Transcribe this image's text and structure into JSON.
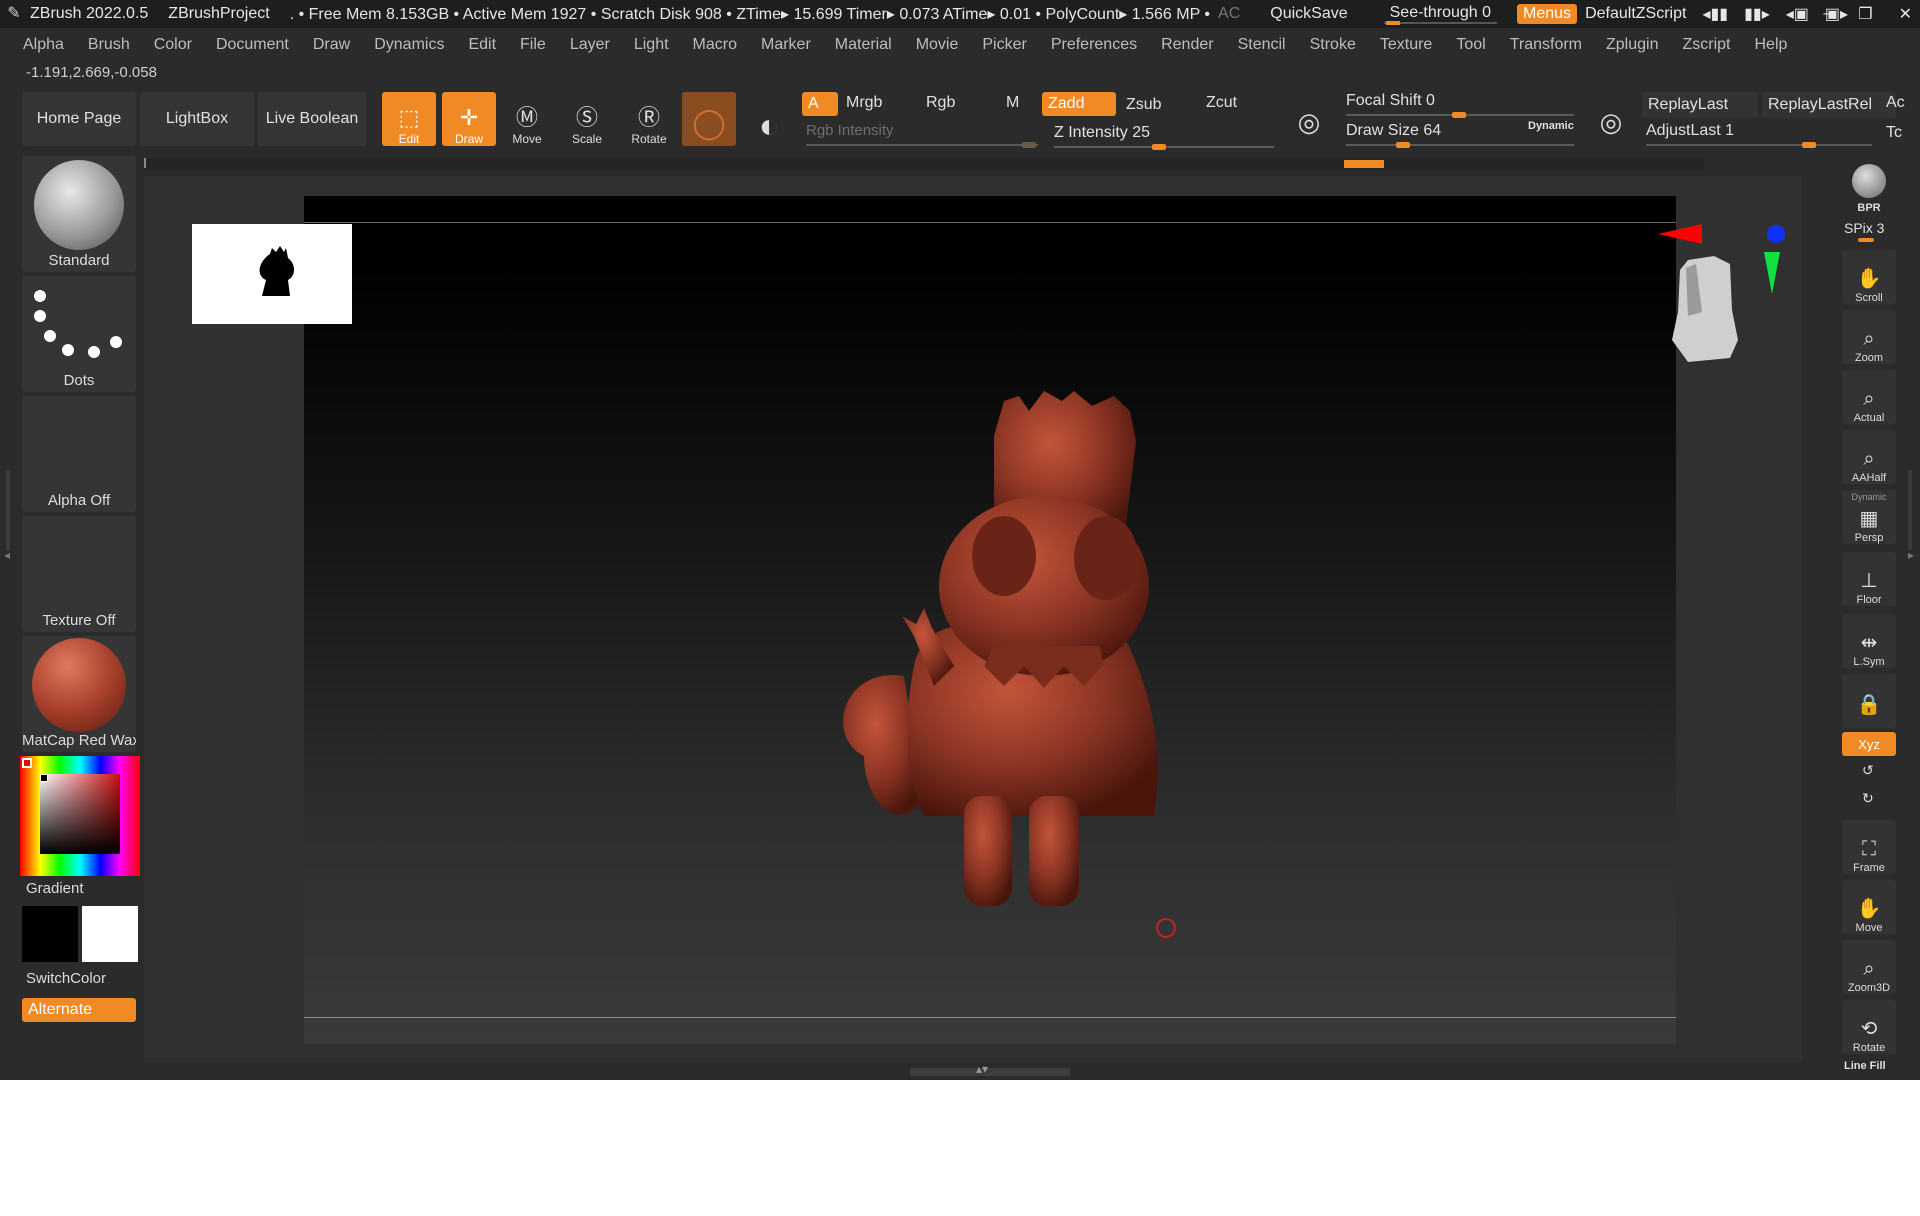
{
  "titlebar": {
    "app": "ZBrush 2022.0.5",
    "project": "ZBrushProject",
    "stats": ". • Free Mem 8.153GB • Active Mem 1927 • Scratch Disk 908 • ZTime▸ 15.699 Timer▸ 0.073 ATime▸ 0.01 • PolyCount▸ 1.566 MP •",
    "ac": "AC",
    "quicksave": "QuickSave",
    "see_through": "See-through  0",
    "menus": "Menus",
    "default_zscript": "DefaultZScript"
  },
  "menubar": [
    "Alpha",
    "Brush",
    "Color",
    "Document",
    "Draw",
    "Dynamics",
    "Edit",
    "File",
    "Layer",
    "Light",
    "Macro",
    "Marker",
    "Material",
    "Movie",
    "Picker",
    "Preferences",
    "Render",
    "Stencil",
    "Stroke",
    "Texture",
    "Tool",
    "Transform",
    "Zplugin",
    "Zscript",
    "Help"
  ],
  "coords": "-1.191,2.669,-0.058",
  "toolbar": {
    "home_page": "Home Page",
    "lightbox": "LightBox",
    "live_boolean": "Live Boolean",
    "edit": "Edit",
    "draw": "Draw",
    "move": "Move",
    "scale": "Scale",
    "rotate": "Rotate",
    "a": "A",
    "mrgb": "Mrgb",
    "rgb": "Rgb",
    "m": "M",
    "zadd": "Zadd",
    "zsub": "Zsub",
    "zcut": "Zcut",
    "rgb_intensity": "Rgb Intensity",
    "z_intensity": "Z Intensity 25",
    "focal_shift": "Focal Shift 0",
    "draw_size": "Draw Size 64",
    "dynamic": "Dynamic",
    "replay_last": "ReplayLast",
    "replay_last_rel": "ReplayLastRel",
    "adjust_last": "AdjustLast 1",
    "ac_cut": "Ac",
    "tc_cut": "Tc"
  },
  "left_shelf": {
    "brush": "Standard",
    "stroke": "Dots",
    "alpha": "Alpha Off",
    "texture": "Texture Off",
    "material": "MatCap Red Wax",
    "gradient": "Gradient",
    "switch_color": "SwitchColor",
    "alternate": "Alternate"
  },
  "right_shelf": {
    "bpr": "BPR",
    "spix": "SPix 3",
    "scroll": "Scroll",
    "zoom": "Zoom",
    "actual": "Actual",
    "aahalf": "AAHalf",
    "dynamic": "Dynamic",
    "persp": "Persp",
    "floor": "Floor",
    "lsym": "L.Sym",
    "xyz": "Xyz",
    "frame": "Frame",
    "move": "Move",
    "zoom3d": "Zoom3D",
    "rotate": "Rotate",
    "line_fill": "Line Fill"
  },
  "colors": {
    "accent": "#f08a24",
    "background": "#2b2b2b",
    "model": "#8e3a28"
  }
}
